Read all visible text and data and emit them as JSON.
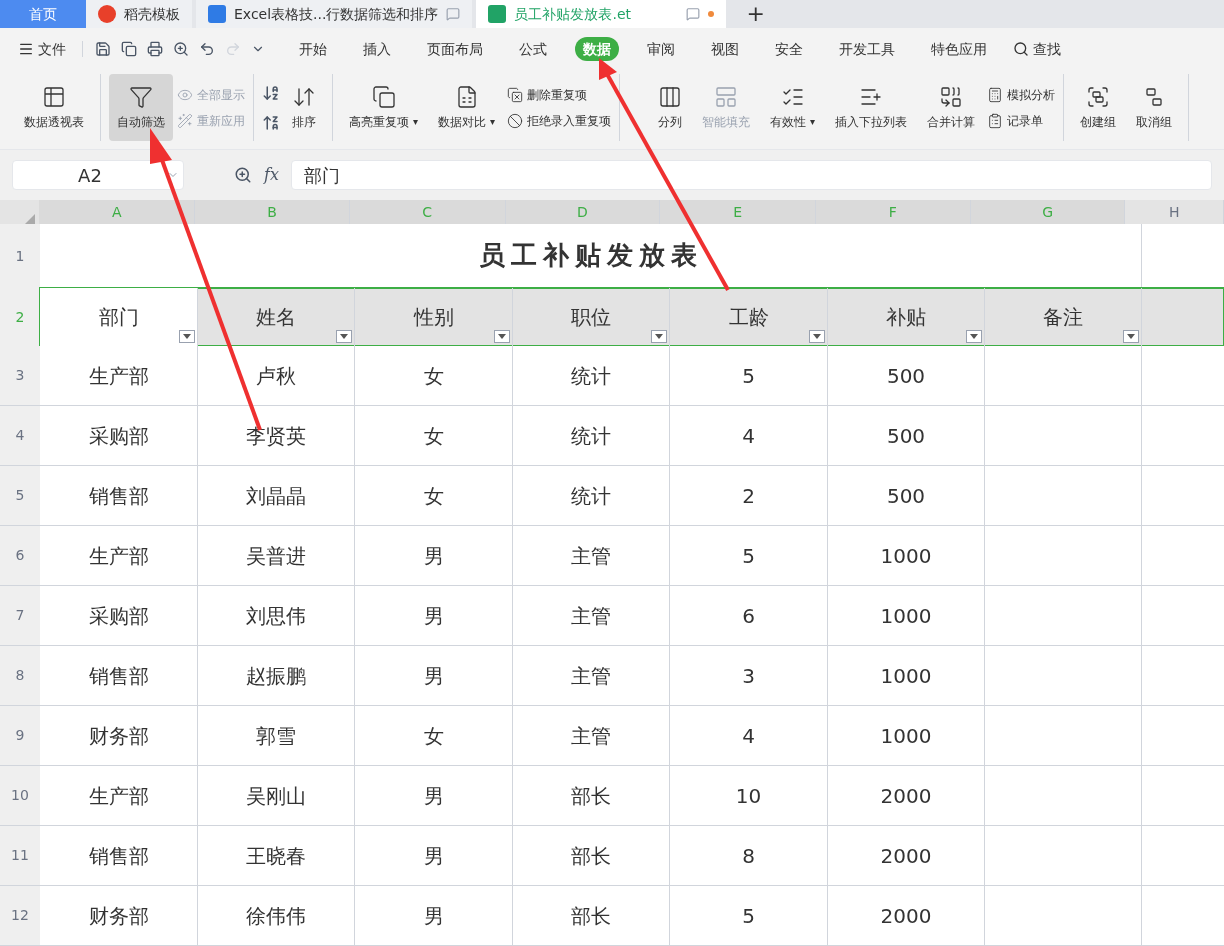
{
  "tabs": [
    {
      "label": "首页",
      "selected": false,
      "kind": "home"
    },
    {
      "label": "稻壳模板",
      "selected": false,
      "kind": "template"
    },
    {
      "label": "Excel表格技...行数据筛选和排序",
      "selected": false,
      "kind": "word"
    },
    {
      "label": "员工补贴发放表.et",
      "selected": true,
      "kind": "sheet"
    }
  ],
  "new_tab": "+",
  "menu": {
    "file": "文件",
    "items": [
      {
        "label": "开始",
        "selected": false
      },
      {
        "label": "插入",
        "selected": false
      },
      {
        "label": "页面布局",
        "selected": false
      },
      {
        "label": "公式",
        "selected": false
      },
      {
        "label": "数据",
        "selected": true
      },
      {
        "label": "审阅",
        "selected": false
      },
      {
        "label": "视图",
        "selected": false
      },
      {
        "label": "安全",
        "selected": false
      },
      {
        "label": "开发工具",
        "selected": false
      },
      {
        "label": "特色应用",
        "selected": false
      }
    ],
    "search": "查找"
  },
  "ribbon": [
    [
      {
        "kind": "large",
        "label": "数据透视表",
        "selected": false,
        "disabled": false
      }
    ],
    [
      {
        "kind": "large",
        "label": "自动筛选",
        "selected": true,
        "disabled": false
      },
      {
        "kind": "stack",
        "items": [
          {
            "label": "全部显示",
            "disabled": true
          },
          {
            "label": "重新应用",
            "disabled": true
          }
        ]
      }
    ],
    [
      {
        "kind": "sortpair"
      },
      {
        "kind": "large",
        "label": "排序",
        "selected": false,
        "disabled": false
      }
    ],
    [
      {
        "kind": "large",
        "label": "高亮重复项",
        "dropdown": "▾",
        "selected": false,
        "disabled": false
      },
      {
        "kind": "large",
        "label": "数据对比",
        "dropdown": "▾",
        "selected": false,
        "disabled": false
      },
      {
        "kind": "stack",
        "items": [
          {
            "label": "删除重复项",
            "disabled": false
          },
          {
            "label": "拒绝录入重复项",
            "disabled": false
          }
        ]
      }
    ],
    [
      {
        "kind": "large",
        "label": "分列",
        "selected": false,
        "disabled": false
      },
      {
        "kind": "large",
        "label": "智能填充",
        "selected": false,
        "disabled": true
      },
      {
        "kind": "large",
        "label": "有效性",
        "dropdown": "▾",
        "selected": false,
        "disabled": false
      },
      {
        "kind": "large",
        "label": "插入下拉列表",
        "selected": false,
        "disabled": false
      },
      {
        "kind": "large",
        "label": "合并计算",
        "selected": false,
        "disabled": false
      },
      {
        "kind": "stack",
        "items": [
          {
            "label": "模拟分析",
            "disabled": false
          },
          {
            "label": "记录单",
            "disabled": false
          }
        ]
      }
    ],
    [
      {
        "kind": "large",
        "label": "创建组",
        "selected": false,
        "disabled": false
      },
      {
        "kind": "large",
        "label": "取消组",
        "selected": false,
        "disabled": false
      }
    ]
  ],
  "name_box": "A2",
  "fx": "fx",
  "formula": "部门",
  "sheet": {
    "columns": [
      {
        "label": "A",
        "selected": true
      },
      {
        "label": "B",
        "selected": true
      },
      {
        "label": "C",
        "selected": true
      },
      {
        "label": "D",
        "selected": true
      },
      {
        "label": "E",
        "selected": true
      },
      {
        "label": "F",
        "selected": true
      },
      {
        "label": "G",
        "selected": true
      },
      {
        "label": "H",
        "selected": false
      }
    ],
    "title_row": {
      "number": "1",
      "title": "员工补贴发放表"
    },
    "header_row": {
      "number": "2",
      "selected": true,
      "cells": [
        "部门",
        "姓名",
        "性别",
        "职位",
        "工龄",
        "补贴",
        "备注"
      ]
    },
    "rows": [
      {
        "number": "3",
        "cells": [
          "生产部",
          "卢秋",
          "女",
          "统计",
          "5",
          "500",
          ""
        ]
      },
      {
        "number": "4",
        "cells": [
          "采购部",
          "李贤英",
          "女",
          "统计",
          "4",
          "500",
          ""
        ]
      },
      {
        "number": "5",
        "cells": [
          "销售部",
          "刘晶晶",
          "女",
          "统计",
          "2",
          "500",
          ""
        ]
      },
      {
        "number": "6",
        "cells": [
          "生产部",
          "吴普进",
          "男",
          "主管",
          "5",
          "1000",
          ""
        ]
      },
      {
        "number": "7",
        "cells": [
          "采购部",
          "刘思伟",
          "男",
          "主管",
          "6",
          "1000",
          ""
        ]
      },
      {
        "number": "8",
        "cells": [
          "销售部",
          "赵振鹏",
          "男",
          "主管",
          "3",
          "1000",
          ""
        ]
      },
      {
        "number": "9",
        "cells": [
          "财务部",
          "郭雪",
          "女",
          "主管",
          "4",
          "1000",
          ""
        ]
      },
      {
        "number": "10",
        "cells": [
          "生产部",
          "吴刚山",
          "男",
          "部长",
          "10",
          "2000",
          ""
        ]
      },
      {
        "number": "11",
        "cells": [
          "销售部",
          "王晓春",
          "男",
          "部长",
          "8",
          "2000",
          ""
        ]
      },
      {
        "number": "12",
        "cells": [
          "财务部",
          "徐伟伟",
          "男",
          "部长",
          "5",
          "2000",
          ""
        ]
      }
    ]
  }
}
